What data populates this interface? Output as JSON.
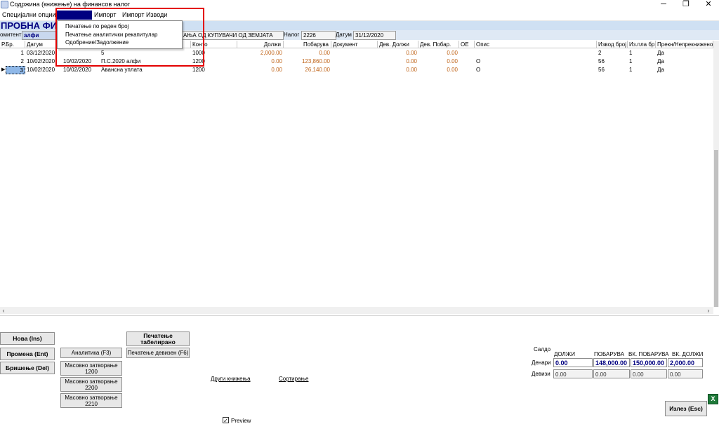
{
  "window": {
    "title": "Содржина (книжење) на финансов налог",
    "minimize": "─",
    "restore": "❐",
    "close": "✕"
  },
  "menu": {
    "items": [
      "Специјални опции",
      "Печатење",
      "Импорт",
      "Импорт Изводи"
    ]
  },
  "dropdown": {
    "items": [
      "Печатење по реден број",
      "Печатење аналитички рекапитулар",
      "Одобрение/Задолжение"
    ]
  },
  "header": {
    "firm": "ПРОБНА ФИР",
    "komitent_label": "омитент",
    "komitent_value": "алфи",
    "desc": "АЊА ОД КУПУВАЧИ ОД ЗЕМЈАТА",
    "nalog_label": "Налог",
    "nalog_value": "2226",
    "datum_label": "Датум",
    "datum_value": "31/12/2020"
  },
  "grid": {
    "columns": [
      "Р.Бр.",
      "Датум",
      "",
      "Конто",
      "Должи",
      "Побарува",
      "Документ",
      "Дев. Должи",
      "Дев. Побар.",
      "ОЕ",
      "Опис",
      "Извод број",
      "Из.пла бр.",
      "Прекн/Непрекнижено"
    ],
    "rows": [
      {
        "rb": "1",
        "datum": "03/12/2020",
        "datum2": "",
        "opis_doc": "5",
        "konto": "1000",
        "dolzi": "2,000.00",
        "pobaruva": "0.00",
        "dokument": "",
        "dev_dolzi": "0.00",
        "dev_pobar": "0.00",
        "oe": "",
        "opis": "",
        "izvod": "2",
        "izpla": "1",
        "prekn": "Да"
      },
      {
        "rb": "2",
        "datum": "10/02/2020",
        "datum2": "10/02/2020",
        "opis_doc": "П.С.2020 алфи",
        "konto": "1200",
        "dolzi": "0.00",
        "pobaruva": "123,860.00",
        "dokument": "",
        "dev_dolzi": "0.00",
        "dev_pobar": "0.00",
        "oe": "",
        "opis": "О",
        "izvod": "56",
        "izpla": "1",
        "prekn": "Да"
      },
      {
        "rb": "3",
        "datum": "10/02/2020",
        "datum2": "10/02/2020",
        "opis_doc": "Авансна уплата",
        "konto": "1200",
        "dolzi": "0.00",
        "pobaruva": "26,140.00",
        "dokument": "",
        "dev_dolzi": "0.00",
        "dev_pobar": "0.00",
        "oe": "",
        "opis": "О",
        "izvod": "56",
        "izpla": "1",
        "prekn": "Да"
      }
    ]
  },
  "buttons": {
    "nova": "Нова (Ins)",
    "promena": "Промена (Ent)",
    "brisenje": "Бришење (Del)",
    "analitika": "Аналитика (F3)",
    "masovno1200": "Масовно затворање 1200",
    "masovno2200": "Масовно затворање 2200",
    "masovno2210": "Масовно затворање 2210",
    "pecatenje_tab": "Печатење табелирано",
    "pecatenje_dev": "Печатење девизен (F6)",
    "izlez": "Излез (Esc)"
  },
  "links": {
    "drugi": "Други книжења",
    "sortiranje": "Сортирање"
  },
  "preview": {
    "label": "Preview",
    "checked": "✓"
  },
  "saldo": {
    "title": "Салдо",
    "headers": [
      "ДОЛЖИ",
      "ПОБАРУВА",
      "ВК. ПОБАРУВА",
      "ВК. ДОЛЖИ"
    ],
    "denari_label": "Денари",
    "denari": [
      "0.00",
      "148,000.00",
      "150,000.00",
      "2,000.00"
    ],
    "devizi_label": "Девизи",
    "devizi": [
      "0.00",
      "0.00",
      "0.00",
      "0.00"
    ]
  },
  "colors": {
    "accent": "#000080",
    "highlight": "#e30000",
    "amount": "#c0651a"
  }
}
